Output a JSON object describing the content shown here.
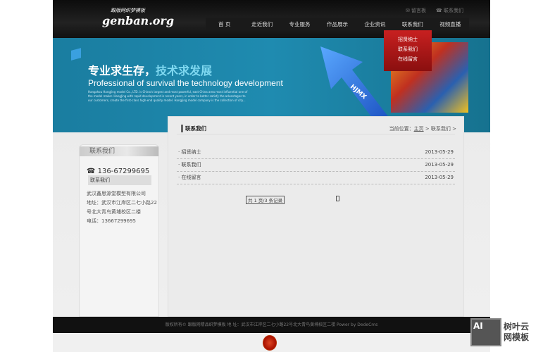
{
  "header": {
    "logo_text": "genban.org",
    "logo_sub": "跟版网织梦模板",
    "top_links": [
      "留言板",
      "联系我们"
    ],
    "nav": [
      "首 页",
      "走近我们",
      "专业服务",
      "作品展示",
      "企业资讯",
      "联系我们",
      "视频直播"
    ],
    "dropdown": [
      "招贤纳士",
      "联系我们",
      "在线留言"
    ]
  },
  "banner": {
    "title_a": "专业求生存，",
    "title_b": "技术求发展",
    "subtitle": "Professional of survival the technology development",
    "body": "Hangzhou HangJing model Co., LTD. is China's largest and most powerful, east China area most influential one of the model maker. HangJing with rapid development in recent years, in order to better satisfy the advantages to our customers, create the first-class high-end quality model. HangJing model company is the collection of city...",
    "badge": "HJMX"
  },
  "sidebar": {
    "title": "联系我们",
    "phone": "136-67299695",
    "contact_title": "联系我们",
    "company": "武汉鑫思源堂模型有限公司",
    "address": "地址：武汉市江岸区二七小路22号北大青鸟黄埔校区二楼",
    "tel": "电话：13667299695"
  },
  "main": {
    "title": "联系我们",
    "breadcrumb_prefix": "当前位置：",
    "breadcrumb_home": "主页",
    "breadcrumb_sep": " > ",
    "breadcrumb_current": "联系我们 >",
    "items": [
      {
        "title": "招贤纳士",
        "date": "2013-05-29"
      },
      {
        "title": "联系我们",
        "date": "2013-05-29"
      },
      {
        "title": "在线留言",
        "date": "2013-05-29"
      }
    ],
    "pager": "共 1 页/3 条记录"
  },
  "footer": {
    "text": "版权所有© 跟版网精品织梦模板 地 址：武汉市江岸区二七小路22号北大青鸟黄埔校区二楼 Power by DedeCms"
  },
  "watermark": {
    "box": "AI",
    "line1": "树叶云",
    "line2": "网模板"
  }
}
